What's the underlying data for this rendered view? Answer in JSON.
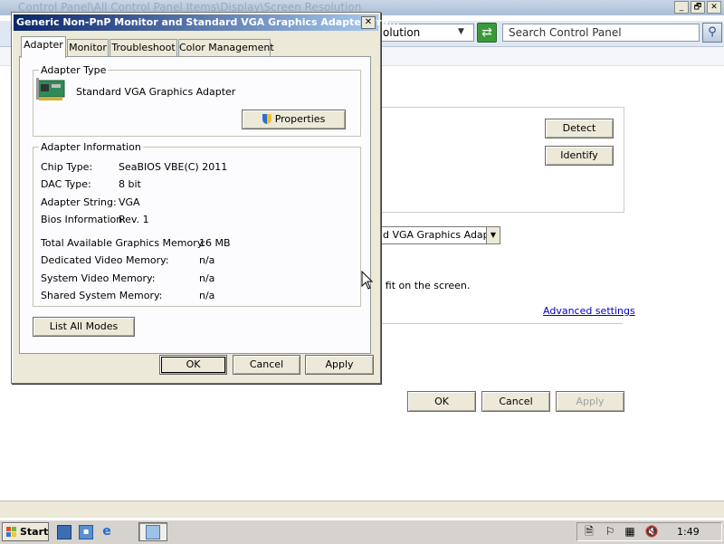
{
  "background_window": {
    "title": "Control Panel\\All Control Panel Items\\Display\\Screen Resolution",
    "caption_buttons": [
      "_",
      "🗗",
      "✕"
    ],
    "address_text": "olution",
    "search_placeholder": "Search Control Panel",
    "buttons": {
      "detect": "Detect",
      "identify": "Identify"
    },
    "advanced_combo_value": "d VGA Graphics Adapter",
    "fit_text": "t fit on the screen.",
    "advanced_link": "Advanced settings",
    "bottom_buttons": {
      "ok": "OK",
      "cancel": "Cancel",
      "apply": "Apply"
    }
  },
  "dialog": {
    "title": "Generic Non-PnP Monitor and Standard VGA Graphics Adapter Pro...",
    "close_glyph": "✕",
    "tabs": [
      {
        "label": "Adapter",
        "active": true
      },
      {
        "label": "Monitor",
        "active": false
      },
      {
        "label": "Troubleshoot",
        "active": false
      },
      {
        "label": "Color Management",
        "active": false
      }
    ],
    "adapter_type": {
      "legend": "Adapter Type",
      "name": "Standard VGA Graphics Adapter",
      "properties_button": "Properties"
    },
    "adapter_info": {
      "legend": "Adapter Information",
      "rows": [
        {
          "label": "Chip Type:",
          "value": "SeaBIOS VBE(C) 2011"
        },
        {
          "label": "DAC Type:",
          "value": "8 bit"
        },
        {
          "label": "Adapter String:",
          "value": "VGA"
        },
        {
          "label": "Bios Information:",
          "value": "Rev. 1"
        }
      ],
      "memory_rows": [
        {
          "label": "Total Available Graphics Memory:",
          "value": "16 MB"
        },
        {
          "label": "Dedicated Video Memory:",
          "value": "n/a"
        },
        {
          "label": "System Video Memory:",
          "value": "n/a"
        },
        {
          "label": "Shared System Memory:",
          "value": "n/a"
        }
      ]
    },
    "list_all_modes_button": "List All Modes",
    "buttons": {
      "ok": "OK",
      "cancel": "Cancel",
      "apply": "Apply"
    }
  },
  "taskbar": {
    "start_label": "Start",
    "clock": "1:49"
  },
  "colors": {
    "dialog_title_start": "#0a246a",
    "dialog_title_end": "#a6caf0",
    "link": "#0000cc"
  }
}
